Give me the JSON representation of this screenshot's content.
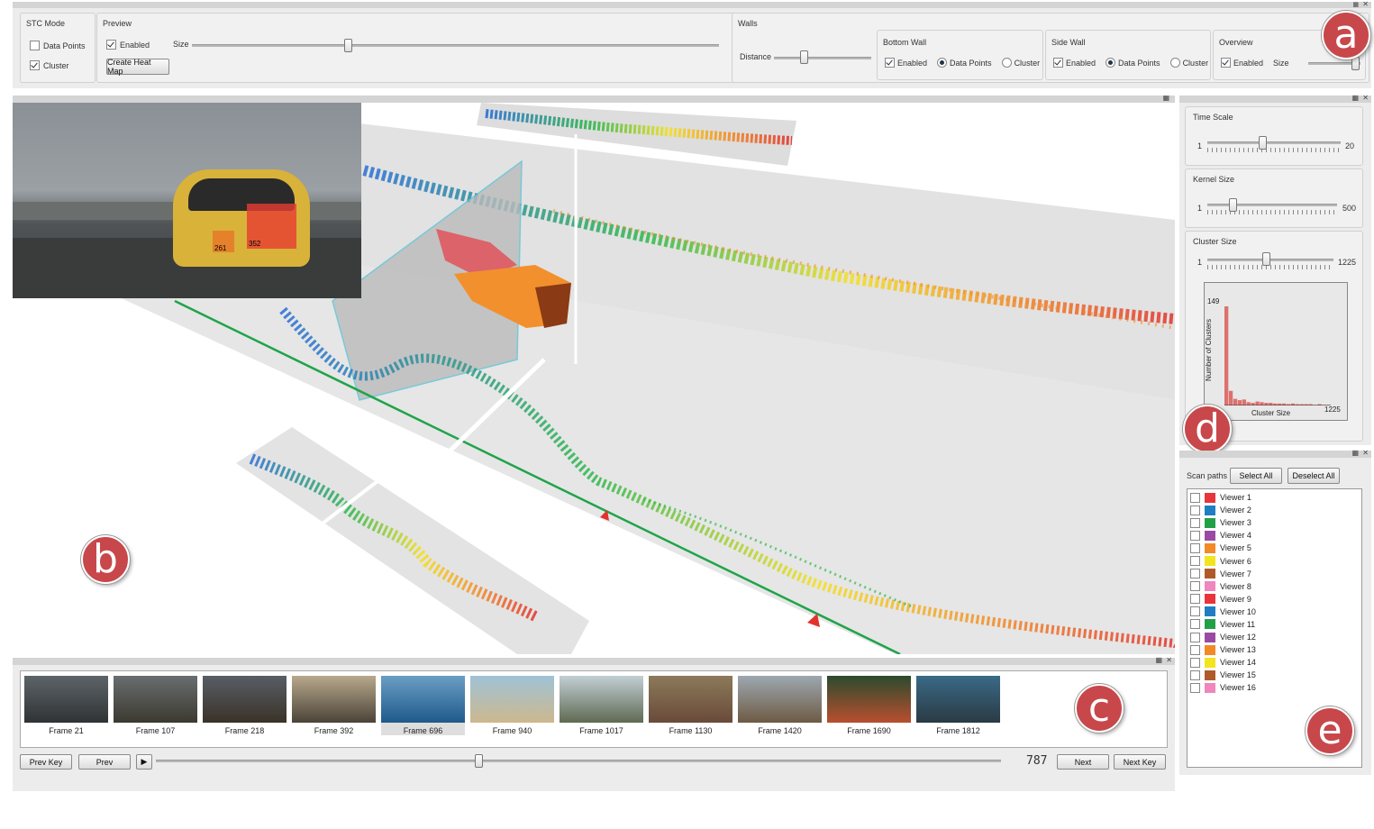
{
  "toolbar": {
    "stc_mode": {
      "title": "STC Mode",
      "data_points": "Data Points",
      "cluster": "Cluster",
      "data_points_checked": false,
      "cluster_checked": true
    },
    "preview": {
      "title": "Preview",
      "enabled": "Enabled",
      "size": "Size",
      "create_heat_map": "Create Heat Map"
    },
    "walls": {
      "title": "Walls",
      "distance": "Distance",
      "bottom_wall": {
        "title": "Bottom Wall",
        "enabled": "Enabled",
        "data_points": "Data Points",
        "cluster": "Cluster"
      },
      "side_wall": {
        "title": "Side Wall",
        "enabled": "Enabled",
        "data_points": "Data Points",
        "cluster": "Cluster"
      },
      "overview": {
        "title": "Overview",
        "enabled": "Enabled",
        "size": "Size"
      }
    }
  },
  "badges": {
    "a": "a",
    "b": "b",
    "c": "c",
    "d": "d",
    "e": "e"
  },
  "settings": {
    "time_scale": {
      "label": "Time Scale",
      "min": "1",
      "max": "20"
    },
    "kernel_size": {
      "label": "Kernel Size",
      "min": "1",
      "max": "500"
    },
    "cluster_size": {
      "label": "Cluster Size",
      "min": "1",
      "max": "1225"
    }
  },
  "histogram": {
    "ymax_label": "149",
    "xmax_label": "1225",
    "ylabel": "Number of Clusters",
    "xlabel": "Cluster Size",
    "bar_color": "#d9534f"
  },
  "chart_data": {
    "type": "bar",
    "xlabel": "Cluster Size",
    "ylabel": "Number of Clusters",
    "ylim": [
      0,
      149
    ],
    "xlim": [
      1,
      1225
    ],
    "values": [
      149,
      22,
      10,
      8,
      9,
      5,
      4,
      6,
      5,
      4,
      4,
      3,
      3,
      3,
      2,
      3,
      2,
      2,
      2,
      2,
      1,
      2,
      1,
      1
    ]
  },
  "preview_overlay": {
    "label_left": "261",
    "label_right": "352"
  },
  "timeline": {
    "frames": [
      {
        "label": "Frame 21",
        "top": "#5d6469",
        "bottom": "#2f3335"
      },
      {
        "label": "Frame 107",
        "top": "#6a6e70",
        "bottom": "#3b3a30"
      },
      {
        "label": "Frame 218",
        "top": "#585e66",
        "bottom": "#3a3228"
      },
      {
        "label": "Frame 392",
        "top": "#b8a98c",
        "bottom": "#4b4338"
      },
      {
        "label": "Frame 696",
        "top": "#6a9ec4",
        "bottom": "#1f5a8c"
      },
      {
        "label": "Frame 940",
        "top": "#9fc2d6",
        "bottom": "#cdb88e"
      },
      {
        "label": "Frame 1017",
        "top": "#c2cfd4",
        "bottom": "#5f6a52"
      },
      {
        "label": "Frame 1130",
        "top": "#8c7a5a",
        "bottom": "#6a4a3a"
      },
      {
        "label": "Frame 1420",
        "top": "#9da8b0",
        "bottom": "#6e5a44"
      },
      {
        "label": "Frame 1690",
        "top": "#2c4a2e",
        "bottom": "#b94f2e"
      },
      {
        "label": "Frame 1812",
        "top": "#3a6a86",
        "bottom": "#2a3a44"
      }
    ],
    "prev_key": "Prev Key",
    "prev": "Prev",
    "next": "Next",
    "next_key": "Next Key",
    "current_frame": "787"
  },
  "scanpaths": {
    "label": "Scan paths",
    "select_all": "Select All",
    "deselect_all": "Deselect All",
    "viewers": [
      {
        "name": "Viewer 1",
        "color": "#e8343a"
      },
      {
        "name": "Viewer 2",
        "color": "#1f7ec2"
      },
      {
        "name": "Viewer 3",
        "color": "#22a047"
      },
      {
        "name": "Viewer 4",
        "color": "#9b4aa3"
      },
      {
        "name": "Viewer 5",
        "color": "#f28a25"
      },
      {
        "name": "Viewer 6",
        "color": "#f2e51f"
      },
      {
        "name": "Viewer 7",
        "color": "#b05a2a"
      },
      {
        "name": "Viewer 8",
        "color": "#ef86bd"
      },
      {
        "name": "Viewer 9",
        "color": "#e8343a"
      },
      {
        "name": "Viewer 10",
        "color": "#1f7ec2"
      },
      {
        "name": "Viewer 11",
        "color": "#22a047"
      },
      {
        "name": "Viewer 12",
        "color": "#9b4aa3"
      },
      {
        "name": "Viewer 13",
        "color": "#f28a25"
      },
      {
        "name": "Viewer 14",
        "color": "#f2e51f"
      },
      {
        "name": "Viewer 15",
        "color": "#b05a2a"
      },
      {
        "name": "Viewer 16",
        "color": "#ef86bd"
      }
    ]
  }
}
